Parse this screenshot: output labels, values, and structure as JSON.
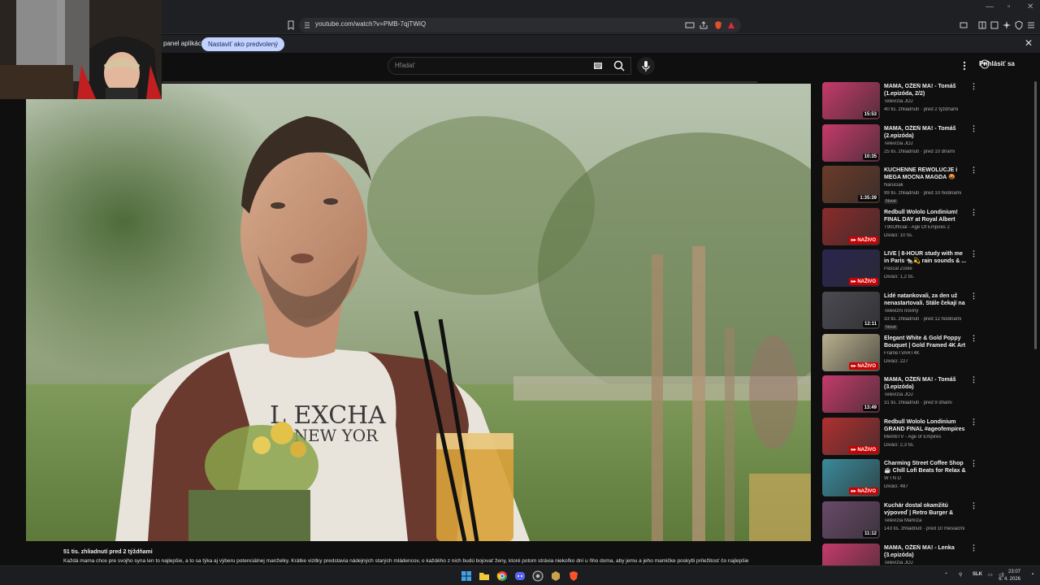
{
  "browser": {
    "url": "youtube.com/watch?v=PMB-7qjTWiQ",
    "infobar_text": "panel aplikácií",
    "infobar_button": "Nastaviť ako predvolený"
  },
  "youtube": {
    "search_placeholder": "Hľadať",
    "signin_label": "Prihlásiť sa",
    "progress_fraction": 0.0
  },
  "video": {
    "shirt_text_line1": "L EXCHA",
    "shirt_text_line2": "Y NEW YOR"
  },
  "description": {
    "meta": "51 tis. zhliadnutí  pred 2 týždňami",
    "text": "Každá mama chce pre svojho syna len to najlepšie, a to sa týka aj výberu potenciálnej manželky. Krátke vizitky predstavia nádejných starých mládencov, o každého z nich budú bojovať ženy, ktoré potom strávia niekoľko dní u ňho doma, aby jemu a jeho mamičke poskytli príležitosť čo najlepšie"
  },
  "recommendations": [
    {
      "title": "MAMA, OŽEŇ MA! - Tomáš (1.epizóda, 2/2)",
      "channel": "Televízia JOJ",
      "meta": "40 tis. zhliadnutí · pred 2 týždňami",
      "duration": "15:53",
      "live": false,
      "badge": "",
      "thumb_color": "#c43a6a"
    },
    {
      "title": "MAMA, OŽEŇ MA! - Tomáš (2.epizóda)",
      "channel": "Televízia JOJ",
      "meta": "25 tis. zhliadnutí · pred 10 dňami",
      "duration": "10:35",
      "live": false,
      "badge": "",
      "thumb_color": "#c43a6a"
    },
    {
      "title": "KUCHENNE REWOLUCJE i MEGA MOCNA MAGDA 🤬",
      "channel": "Naruciak",
      "meta": "99 tis. zhliadnutí · pred 10 hodinami",
      "duration": "1:35:39",
      "live": false,
      "badge": "Nové",
      "thumb_color": "#6b3b2a"
    },
    {
      "title": "Redbull Wololo Londinium! FINAL DAY at Royal Albert Hall!",
      "channel": "T90Official - Age Of Empires 2",
      "meta": "Diváci: 10 tis.",
      "duration": "",
      "live": true,
      "badge": "",
      "thumb_color": "#8a2b2b"
    },
    {
      "title": "LIVE | 8-HOUR study with me in Paris 🐀💫 rain sounds & ...",
      "channel": "Pascal Zoole",
      "meta": "Diváci: 1,2 tis.",
      "duration": "",
      "live": true,
      "badge": "",
      "thumb_color": "#2a2550"
    },
    {
      "title": "Lidé natankovali, za den už nenastartovali. Stále čekají na ...",
      "channel": "Televizní noviny",
      "meta": "33 tis. zhliadnutí · pred 12 hodinami",
      "duration": "12:11",
      "live": false,
      "badge": "Nové",
      "thumb_color": "#4a4a52"
    },
    {
      "title": "Elegant White & Gold Poppy Bouquet | Gold Framed 4K Art ...",
      "channel": "FrameTVART4K",
      "meta": "Diváci: 227",
      "duration": "",
      "live": true,
      "badge": "",
      "thumb_color": "#b9b08e"
    },
    {
      "title": "MAMA, OŽEŇ MA! - Tomáš (3.epizóda)",
      "channel": "Televízia JOJ",
      "meta": "31 tis. zhliadnutí · pred 9 dňami",
      "duration": "13:49",
      "live": false,
      "badge": "",
      "thumb_color": "#c43a6a"
    },
    {
      "title": "Redbull Wololo Londinium GRAND FINAL #ageofempires",
      "channel": "MembTV - Age of Empires",
      "meta": "Diváci: 2,3 tis.",
      "duration": "",
      "live": true,
      "badge": "",
      "thumb_color": "#b03030"
    },
    {
      "title": "Charming Street Coffee Shop ☕ Chill Lofi Beats for Relax & ...",
      "channel": "W I N D",
      "meta": "Diváci: 487",
      "duration": "",
      "live": true,
      "badge": "",
      "thumb_color": "#3a8a9a"
    },
    {
      "title": "Kuchár dostal okamžitú výpoveď | Retro Burger & Dinn...",
      "channel": "Televízia Markíza",
      "meta": "143 tis. zhliadnutí · pred 10 mesiacmi",
      "duration": "11:12",
      "live": false,
      "badge": "",
      "thumb_color": "#6a4a6a"
    },
    {
      "title": "MAMA, OŽEŇ MA! - Lenka (3.epizóda)",
      "channel": "Televízia JOJ",
      "meta": "",
      "duration": "",
      "live": false,
      "badge": "",
      "thumb_color": "#c43a6a"
    }
  ],
  "live_label": "▸▸ NAŽIVO",
  "taskbar": {
    "lang": "SLK",
    "time": "23:07",
    "date": "6. 4. 2026"
  }
}
